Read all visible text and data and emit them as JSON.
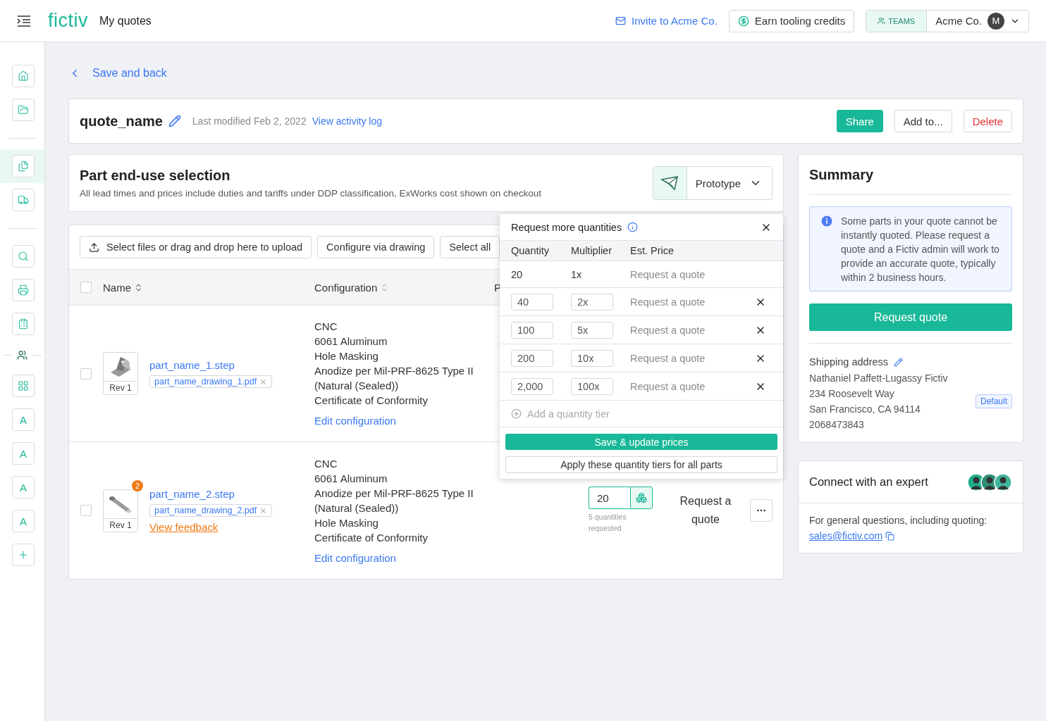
{
  "header": {
    "logo": "fictiv",
    "title": "My quotes",
    "invite": "Invite to Acme Co.",
    "credits": "Earn tooling credits",
    "teams": "TEAMS",
    "org": "Acme Co.",
    "avatar": "M"
  },
  "sidebar": {
    "items": [
      {
        "kind": "home",
        "selected": false
      },
      {
        "kind": "folder",
        "selected": false
      },
      {
        "kind": "divider"
      },
      {
        "kind": "quotes",
        "selected": true
      },
      {
        "kind": "truck",
        "selected": false
      },
      {
        "kind": "divider"
      },
      {
        "kind": "search",
        "selected": false
      },
      {
        "kind": "printer",
        "selected": false
      },
      {
        "kind": "clipboard",
        "selected": false
      },
      {
        "kind": "team-divider"
      },
      {
        "kind": "grid",
        "selected": false
      },
      {
        "kind": "letter",
        "label": "A",
        "selected": false
      },
      {
        "kind": "letter",
        "label": "A",
        "selected": false
      },
      {
        "kind": "letter",
        "label": "A",
        "selected": false
      },
      {
        "kind": "letter",
        "label": "A",
        "selected": false
      },
      {
        "kind": "add",
        "selected": false
      }
    ]
  },
  "back_link": "Save and back",
  "quote": {
    "name": "quote_name",
    "modified": "Last modified Feb 2, 2022",
    "activity_link": "View activity log",
    "actions": [
      {
        "label": "Share",
        "kind": "primary"
      },
      {
        "label": "Add to...",
        "kind": "default"
      },
      {
        "label": "Delete",
        "kind": "danger"
      }
    ]
  },
  "end_use": {
    "title": "Part end-use selection",
    "subtitle": "All lead times and prices include duties and tariffs under DDP classification, ExWorks cost shown on checkout",
    "selector": "Prototype"
  },
  "parts": {
    "toolbar": [
      "Select files or drag and drop here to upload",
      "Configure via drawing",
      "Select all"
    ],
    "all_checked": false,
    "columns": [
      "Name",
      "Configuration",
      "P"
    ],
    "rows": [
      {
        "checked": false,
        "kind": "bracket",
        "rev": "Rev 1",
        "file": "part_name_1.step",
        "drawing": "part_name_drawing_1.pdf",
        "configuration": [
          "CNC",
          "6061 Aluminum",
          "Hole Masking",
          "Anodize per Mil-PRF-8625 Type II",
          "(Natural (Sealed))",
          "Certificate of Conformity"
        ],
        "edit": "Edit configuration"
      },
      {
        "checked": false,
        "kind": "pin",
        "badge": "2",
        "rev": "Rev 1",
        "file": "part_name_2.step",
        "drawing": "part_name_drawing_2.pdf",
        "feedback": "View feedback",
        "configuration": [
          "CNC",
          "6061 Aluminum",
          "Anodize per Mil-PRF-8625 Type II",
          "(Natural (Sealed))",
          "Hole Masking",
          "Certificate of Conformity"
        ],
        "edit": "Edit configuration",
        "quantity": "20",
        "quantity_note": "5 quantities requested",
        "price": "Request a quote"
      }
    ]
  },
  "quantity_popover": {
    "title": "Request more quantities",
    "columns": [
      "Quantity",
      "Multiplier",
      "Est. Price"
    ],
    "tiers": [
      {
        "kind": "fixed",
        "quantity": "20",
        "multiplier": "1x",
        "price": "Request a quote"
      },
      {
        "kind": "editable",
        "quantity": "40",
        "multiplier": "2x",
        "price": "Request a quote"
      },
      {
        "kind": "editable",
        "quantity": "100",
        "multiplier": "5x",
        "price": "Request a quote"
      },
      {
        "kind": "editable",
        "quantity": "200",
        "multiplier": "10x",
        "price": "Request a quote"
      },
      {
        "kind": "editable",
        "quantity": "2,000",
        "multiplier": "100x",
        "price": "Request a quote"
      }
    ],
    "add": "Add a quantity tier",
    "save": "Save & update prices",
    "apply": "Apply these quantity tiers for all parts"
  },
  "summary": {
    "title": "Summary",
    "notice": "Some parts in your quote cannot be instantly quoted. Please request a quote and a Fictiv admin will work to provide an accurate quote, typically within 2 business hours.",
    "request_button": "Request quote",
    "shipping_label": "Shipping address",
    "address": [
      "Nathaniel Paffett-Lugassy Fictiv",
      "234 Roosevelt Way",
      "San Francisco, CA 94114",
      "2068473843"
    ],
    "default_badge": "Default"
  },
  "expert": {
    "title": "Connect with an expert",
    "text": "For general questions, including quoting:",
    "email": "sales@fictiv.com"
  }
}
